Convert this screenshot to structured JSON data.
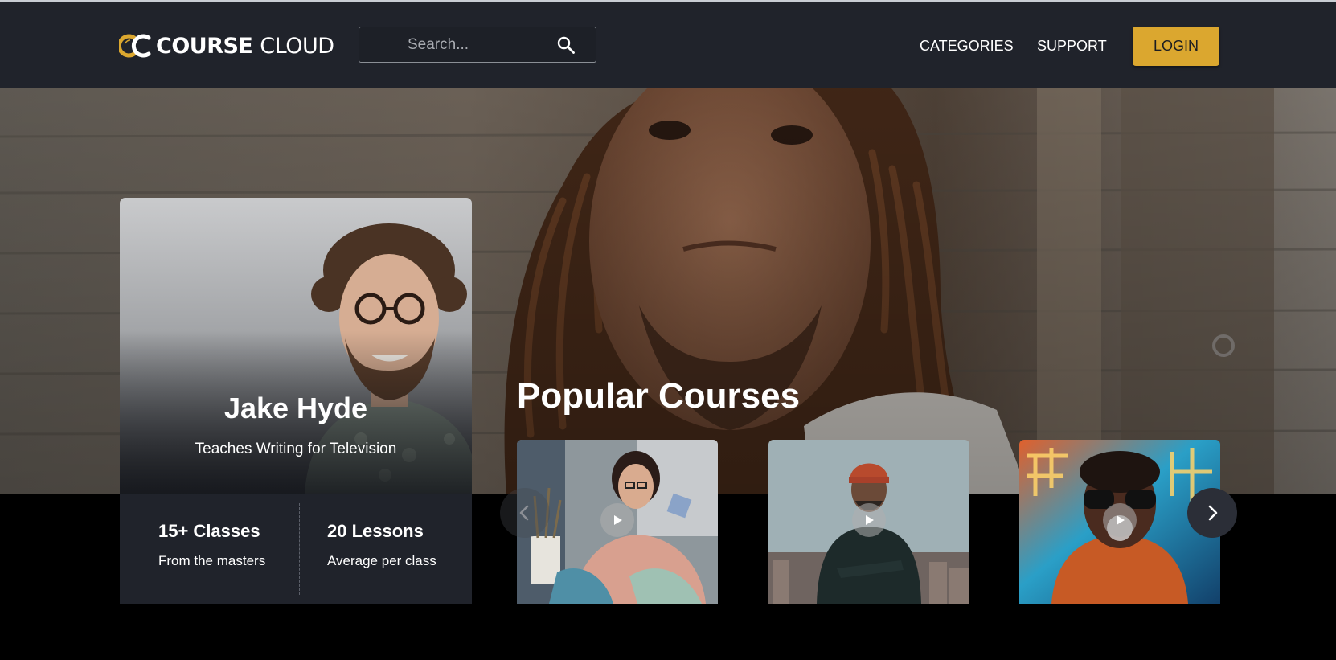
{
  "header": {
    "brand_word_1": "COURSE",
    "brand_word_2": "CLOUD",
    "search_placeholder": "Search...",
    "nav": [
      {
        "label": "CATEGORIES"
      },
      {
        "label": "SUPPORT"
      }
    ],
    "login_label": "LOGIN"
  },
  "instructor": {
    "name": "Jake Hyde",
    "subtitle": "Teaches Writing for Television",
    "stats": [
      {
        "value": "15+ Classes",
        "label": "From the masters"
      },
      {
        "value": "20 Lessons",
        "label": "Average per class"
      }
    ]
  },
  "courses": {
    "title": "Popular Courses",
    "cards": [
      {
        "image": "woman-painting-with-brushes"
      },
      {
        "image": "man-in-beanie-arms-crossed"
      },
      {
        "image": "man-sunglasses-neon-lights"
      }
    ]
  },
  "icons": {
    "search": "search-icon",
    "play": "play-icon",
    "prev": "chevron-left-icon",
    "next": "chevron-right-icon"
  },
  "colors": {
    "header_bg": "#20232b",
    "accent": "#dba72f",
    "stats_bg": "#20232b"
  }
}
